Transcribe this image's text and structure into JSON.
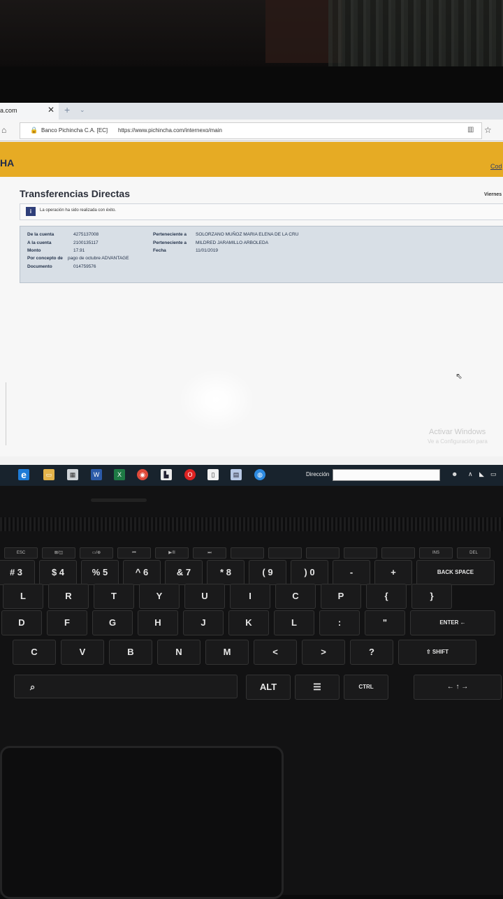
{
  "browser": {
    "tab_title": "a.com",
    "tab_close": "✕",
    "new_tab": "+",
    "site_identity": "Banco Pichincha C.A. [EC]",
    "url": "https://www.pichincha.com/internexo/main"
  },
  "bank": {
    "brand": "HA",
    "header_link": "Cod"
  },
  "page": {
    "title": "Transferencias Directas",
    "date_label": "Viernes",
    "message": "La operación ha sido realizada con éxito."
  },
  "details": {
    "from_account_label": "De la cuenta",
    "from_account_value": "4275137008",
    "from_owner_label": "Perteneciente a",
    "from_owner_value": "SOLORZANO MUÑOZ MARIA ELENA DE LA CRU",
    "to_account_label": "A la cuenta",
    "to_account_value": "2100135117",
    "to_owner_label": "Perteneciente a",
    "to_owner_value": "MILDRED JARAMILLO ARBOLEDA",
    "amount_label": "Monto",
    "amount_value": "17.91",
    "date_label": "Fecha",
    "date_value": "11/01/2019",
    "concept_label": "Por concepto de",
    "concept_value": "pago de octubre ADVANTAGE",
    "document_label": "Documento",
    "document_value": "014759576"
  },
  "windows": {
    "watermark_title": "Activar Windows",
    "watermark_sub": "Ve a Configuración para"
  },
  "taskbar": {
    "address_label": "Dirección"
  },
  "keyboard": {
    "row_numbers": [
      "#\n3",
      "$\n4",
      "%\n5",
      "^\n6",
      "&\n7",
      "*\n8",
      "(\n9",
      ")\n0",
      "-",
      "+",
      "BACK SPACE"
    ],
    "row_top": [
      "L",
      "R",
      "T",
      "Y",
      "U",
      "I",
      "C",
      "P",
      "{",
      "}"
    ],
    "row_home": [
      "D",
      "F",
      "G",
      "H",
      "J",
      "K",
      "L",
      ":",
      "\"",
      "ENTER ←"
    ],
    "row_bottom": [
      "C",
      "V",
      "B",
      "N",
      "M",
      "<",
      ">",
      "?",
      "⇧ SHIFT"
    ],
    "row_space": [
      "ALT",
      "☰",
      "CTRL"
    ],
    "fn_row": [
      "ESC",
      "⊠/◫",
      "▭/⊕",
      "⏮",
      "▶/II",
      "⏭",
      "",
      "",
      "",
      "",
      "",
      "INS",
      "DEL"
    ]
  }
}
